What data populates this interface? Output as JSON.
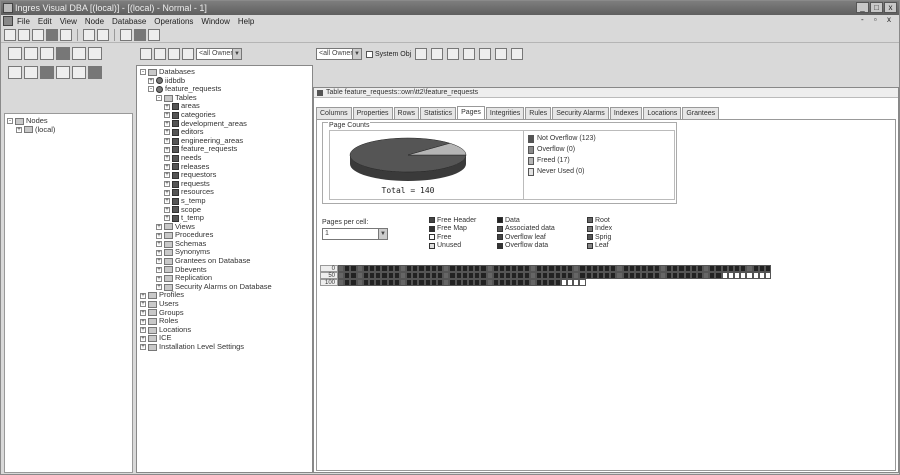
{
  "window": {
    "title": "Ingres Visual DBA [(local)] - [(local) - Normal - 1]",
    "controls": [
      "_",
      "□",
      "x"
    ]
  },
  "menu": {
    "items": [
      "File",
      "Edit",
      "View",
      "Node",
      "Database",
      "Operations",
      "Window",
      "Help"
    ],
    "mdi_controls": "- ▫ x"
  },
  "left_pane": {
    "tree": [
      {
        "label": "Nodes",
        "level": 0,
        "expander": "-"
      },
      {
        "label": "(local)",
        "level": 1,
        "expander": "+"
      }
    ]
  },
  "toolbar2": {
    "combo1": "<all Owners>",
    "combo2": "<all Owners>",
    "system_obj_label": "System Obj"
  },
  "db_tree": [
    {
      "label": "Databases",
      "level": 0,
      "expander": "-",
      "icon": "folder"
    },
    {
      "label": "iidbdb",
      "level": 1,
      "expander": "+",
      "icon": "db"
    },
    {
      "label": "feature_requests",
      "level": 1,
      "expander": "-",
      "icon": "db"
    },
    {
      "label": "Tables",
      "level": 2,
      "expander": "-",
      "icon": "folder"
    },
    {
      "label": "areas",
      "level": 3,
      "expander": "+",
      "icon": "table"
    },
    {
      "label": "categories",
      "level": 3,
      "expander": "+",
      "icon": "table"
    },
    {
      "label": "development_areas",
      "level": 3,
      "expander": "+",
      "icon": "table"
    },
    {
      "label": "editors",
      "level": 3,
      "expander": "+",
      "icon": "table"
    },
    {
      "label": "engineering_areas",
      "level": 3,
      "expander": "+",
      "icon": "table"
    },
    {
      "label": "feature_requests",
      "level": 3,
      "expander": "+",
      "icon": "table"
    },
    {
      "label": "needs",
      "level": 3,
      "expander": "+",
      "icon": "table"
    },
    {
      "label": "releases",
      "level": 3,
      "expander": "+",
      "icon": "table"
    },
    {
      "label": "requestors",
      "level": 3,
      "expander": "+",
      "icon": "table"
    },
    {
      "label": "requests",
      "level": 3,
      "expander": "+",
      "icon": "table"
    },
    {
      "label": "resources",
      "level": 3,
      "expander": "+",
      "icon": "table"
    },
    {
      "label": "s_temp",
      "level": 3,
      "expander": "+",
      "icon": "table"
    },
    {
      "label": "scope",
      "level": 3,
      "expander": "+",
      "icon": "table"
    },
    {
      "label": "t_temp",
      "level": 3,
      "expander": "+",
      "icon": "table"
    },
    {
      "label": "Views",
      "level": 2,
      "expander": "+",
      "icon": "folder"
    },
    {
      "label": "Procedures",
      "level": 2,
      "expander": "+",
      "icon": "folder"
    },
    {
      "label": "Schemas",
      "level": 2,
      "expander": "+",
      "icon": "folder"
    },
    {
      "label": "Synonyms",
      "level": 2,
      "expander": "+",
      "icon": "folder"
    },
    {
      "label": "Grantees on Database",
      "level": 2,
      "expander": "+",
      "icon": "folder"
    },
    {
      "label": "Dbevents",
      "level": 2,
      "expander": "+",
      "icon": "folder"
    },
    {
      "label": "Replication",
      "level": 2,
      "expander": "+",
      "icon": "folder"
    },
    {
      "label": "Security Alarms on Database",
      "level": 2,
      "expander": "+",
      "icon": "folder"
    },
    {
      "label": "Profiles",
      "level": 0,
      "expander": "+",
      "icon": "folder"
    },
    {
      "label": "Users",
      "level": 0,
      "expander": "+",
      "icon": "folder"
    },
    {
      "label": "Groups",
      "level": 0,
      "expander": "+",
      "icon": "folder"
    },
    {
      "label": "Roles",
      "level": 0,
      "expander": "+",
      "icon": "folder"
    },
    {
      "label": "Locations",
      "level": 0,
      "expander": "+",
      "icon": "folder"
    },
    {
      "label": "ICE",
      "level": 0,
      "expander": "+",
      "icon": "folder"
    },
    {
      "label": "Installation Level Settings",
      "level": 0,
      "expander": "+",
      "icon": "folder"
    }
  ],
  "detail": {
    "header": "Table feature_requests::own\\tt2\\feature_requests",
    "tabs": [
      "Columns",
      "Properties",
      "Rows",
      "Statistics",
      "Pages",
      "Integrities",
      "Rules",
      "Security Alarms",
      "Indexes",
      "Locations",
      "Grantees"
    ],
    "active_tab": "Pages",
    "page_counts_label": "Page Counts",
    "total_label": "Total = 140",
    "legend": [
      {
        "label": "Not Overflow (123)",
        "color": "#555555"
      },
      {
        "label": "Overflow (0)",
        "color": "#8a8a8a"
      },
      {
        "label": "Freed (17)",
        "color": "#b5b5b5"
      },
      {
        "label": "Never Used (0)",
        "color": "#e3e3e3"
      }
    ],
    "pages_per_cell_label": "Pages per cell:",
    "pages_per_cell_value": "1",
    "page_types": [
      {
        "label": "Free Header",
        "col": 0,
        "row": 0
      },
      {
        "label": "Free Map",
        "col": 0,
        "row": 1
      },
      {
        "label": "Free",
        "col": 0,
        "row": 2
      },
      {
        "label": "Unused",
        "col": 0,
        "row": 3
      },
      {
        "label": "Data",
        "col": 1,
        "row": 0
      },
      {
        "label": "Associated data",
        "col": 1,
        "row": 1
      },
      {
        "label": "Overflow leaf",
        "col": 1,
        "row": 2
      },
      {
        "label": "Overflow data",
        "col": 1,
        "row": 3
      },
      {
        "label": "Root",
        "col": 2,
        "row": 0
      },
      {
        "label": "Index",
        "col": 2,
        "row": 1
      },
      {
        "label": "Sprig",
        "col": 2,
        "row": 2
      },
      {
        "label": "Leaf",
        "col": 2,
        "row": 3
      }
    ],
    "grid_rows": [
      {
        "label": "0",
        "filled": 70,
        "white": 0
      },
      {
        "label": "50",
        "filled": 62,
        "white": 8
      },
      {
        "label": "100",
        "filled": 36,
        "white": 4
      }
    ]
  },
  "chart_data": {
    "type": "pie",
    "title": "Page Counts",
    "total": 140,
    "categories": [
      "Not Overflow",
      "Overflow",
      "Freed",
      "Never Used"
    ],
    "values": [
      123,
      0,
      17,
      0
    ]
  }
}
